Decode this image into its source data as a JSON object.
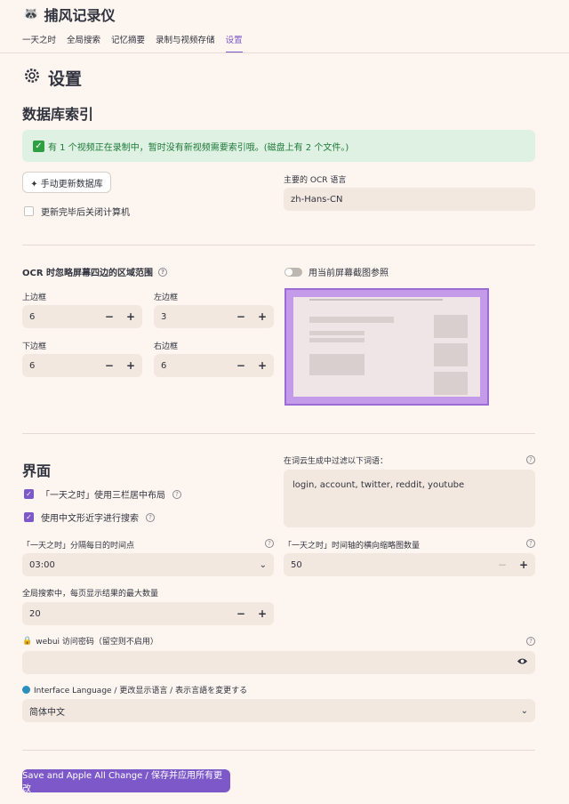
{
  "app": {
    "icon": "raccoon-icon",
    "title": "捕风记录仪"
  },
  "tabs": [
    {
      "label": "一天之时"
    },
    {
      "label": "全局搜索"
    },
    {
      "label": "记忆摘要"
    },
    {
      "label": "录制与视频存储"
    },
    {
      "label": "设置",
      "active": true
    }
  ],
  "page": {
    "title": "设置",
    "title_icon": "gear-icon"
  },
  "db": {
    "title": "数据库索引",
    "alert": "有 1 个视频正在录制中，暂时没有新视频需要索引哦。(磁盘上有 2 个文件。)",
    "update_button": "✦ 手动更新数据库",
    "shutdown_label": "更新完毕后关闭计算机",
    "ocr_lang_label": "主要的 OCR 语言",
    "ocr_lang_value": "zh-Hans-CN"
  },
  "ocr": {
    "title": "OCR 时忽略屏幕四边的区域范围",
    "toggle_label": "用当前屏幕截图参照",
    "top_label": "上边框",
    "top_value": "6",
    "left_label": "左边框",
    "left_value": "3",
    "bottom_label": "下边框",
    "bottom_value": "6",
    "right_label": "右边框",
    "right_value": "6",
    "minus": "−",
    "plus": "+"
  },
  "ui": {
    "title": "界面",
    "three_col_label": "「一天之时」使用三栏居中布局",
    "fuzzy_label": "使用中文形近字进行搜索",
    "filter_label": "在词云生成中过滤以下词语：",
    "filter_value": "login, account, twitter, reddit, youtube",
    "split_label": "「一天之时」分隔每日的时间点",
    "split_value": "03:00",
    "thumb_label": "「一天之时」时间轴的横向缩略图数量",
    "thumb_value": "50",
    "max_results_label": "全局搜索中，每页显示结果的最大数量",
    "max_results_value": "20",
    "password_label": "webui 访问密码（留空则不启用）",
    "lang_label": "Interface Language / 更改显示语言 / 表示言語を変更する",
    "lang_value": "简体中文"
  },
  "save_button": "Save and Apple All Change / 保存并应用所有更改",
  "colors": {
    "accent": "#7c58c8",
    "alert_bg": "#dff1e3",
    "alert_text": "#1e7a3a",
    "field_bg": "#f3e8e0"
  }
}
